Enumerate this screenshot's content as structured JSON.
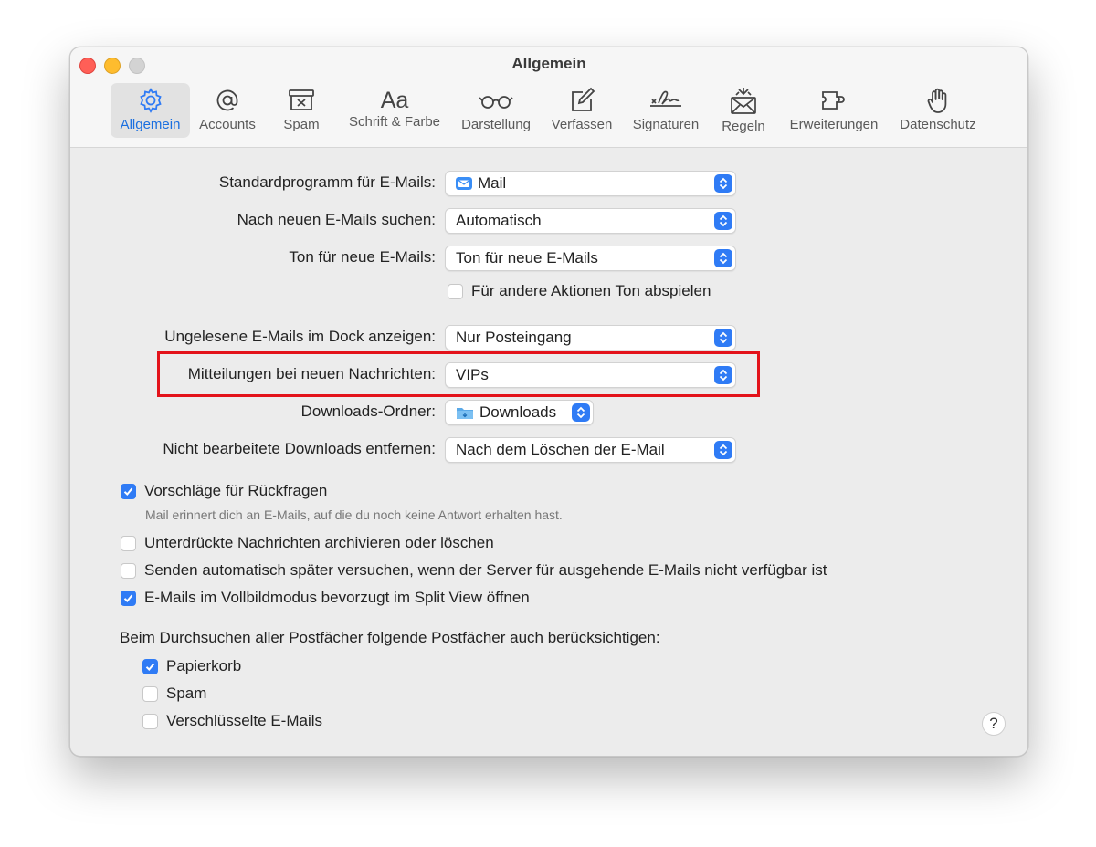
{
  "window": {
    "title": "Allgemein"
  },
  "tabs": [
    {
      "label": "Allgemein",
      "icon": "gear-icon",
      "active": true
    },
    {
      "label": "Accounts",
      "icon": "at-icon"
    },
    {
      "label": "Spam",
      "icon": "junk-icon"
    },
    {
      "label": "Schrift & Farbe",
      "icon": "font-icon"
    },
    {
      "label": "Darstellung",
      "icon": "glasses-icon"
    },
    {
      "label": "Verfassen",
      "icon": "compose-icon"
    },
    {
      "label": "Signaturen",
      "icon": "signature-icon"
    },
    {
      "label": "Regeln",
      "icon": "rules-icon"
    },
    {
      "label": "Erweiterungen",
      "icon": "puzzle-icon"
    },
    {
      "label": "Datenschutz",
      "icon": "hand-icon"
    }
  ],
  "settings": {
    "default_mail": {
      "label": "Standardprogramm für E-Mails:",
      "value": "Mail"
    },
    "check_mail": {
      "label": "Nach neuen E-Mails suchen:",
      "value": "Automatisch"
    },
    "new_mail_sound": {
      "label": "Ton für neue E-Mails:",
      "value": "Ton für neue E-Mails"
    },
    "play_sounds": {
      "label": "Für andere Aktionen Ton abspielen",
      "checked": false
    },
    "dock_unread": {
      "label": "Ungelesene E-Mails im Dock anzeigen:",
      "value": "Nur Posteingang"
    },
    "notifications": {
      "label": "Mitteilungen bei neuen Nachrichten:",
      "value": "VIPs"
    },
    "downloads_folder": {
      "label": "Downloads-Ordner:",
      "value": "Downloads"
    },
    "remove_downloads": {
      "label": "Nicht bearbeitete Downloads entfernen:",
      "value": "Nach dem Löschen der E-Mail"
    }
  },
  "checkboxes": {
    "followup": {
      "label": "Vorschläge für Rückfragen",
      "checked": true,
      "sub": "Mail erinnert dich an E-Mails, auf die du noch keine Antwort erhalten hast."
    },
    "muted": {
      "label": "Unterdrückte Nachrichten archivieren oder löschen",
      "checked": false
    },
    "retry_send": {
      "label": "Senden automatisch später versuchen, wenn der Server für ausgehende E-Mails nicht verfügbar ist",
      "checked": false
    },
    "splitview": {
      "label": "E-Mails im Vollbildmodus bevorzugt im Split View öffnen",
      "checked": true
    }
  },
  "search": {
    "heading": "Beim Durchsuchen aller Postfächer folgende Postfächer auch berücksichtigen:",
    "trash": {
      "label": "Papierkorb",
      "checked": true
    },
    "spam": {
      "label": "Spam",
      "checked": false
    },
    "encrypted": {
      "label": "Verschlüsselte E-Mails",
      "checked": false
    }
  },
  "help": {
    "label": "?"
  },
  "colors": {
    "accent": "#2f7bf5",
    "highlight": "#e3121a"
  }
}
